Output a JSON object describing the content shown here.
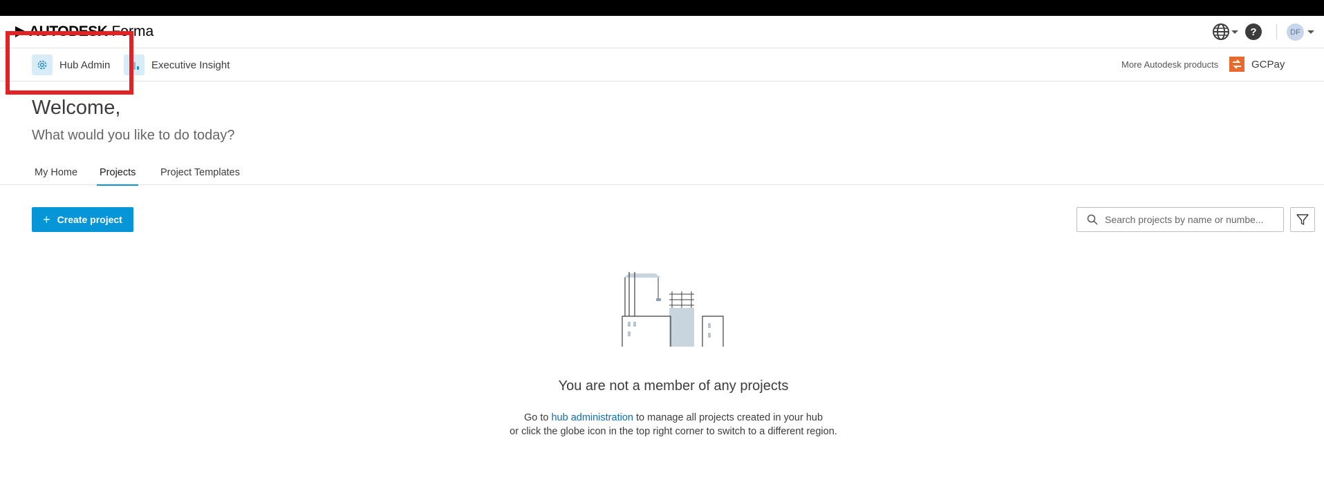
{
  "header": {
    "brand": "AUTODESK",
    "product": "Forma",
    "avatar_initials": "DF",
    "help_glyph": "?"
  },
  "apps": {
    "hub_admin": "Hub Admin",
    "executive_insight": "Executive Insight",
    "more_products": "More Autodesk products",
    "gcpay": "GCPay"
  },
  "page": {
    "welcome": "Welcome,",
    "subtitle": "What would you like to do today?"
  },
  "tabs": [
    {
      "label": "My Home",
      "active": false
    },
    {
      "label": "Projects",
      "active": true
    },
    {
      "label": "Project Templates",
      "active": false
    }
  ],
  "toolbar": {
    "create_label": "Create project",
    "search_placeholder": "Search projects by name or numbe..."
  },
  "empty_state": {
    "title": "You are not a member of any projects",
    "line1_prefix": "Go to ",
    "line1_link": "hub administration",
    "line1_suffix": " to manage all projects created in your hub",
    "line2": "or click the globe icon in the top right corner to switch to a different region."
  },
  "colors": {
    "accent": "#0696d7",
    "highlight": "#e32226",
    "gcpay": "#e86a2c"
  },
  "icons": [
    "autodesk-logo-icon",
    "globe-icon",
    "help-icon",
    "gear-icon",
    "chart-icon",
    "gcpay-icon",
    "plus-icon",
    "search-icon",
    "filter-icon"
  ]
}
